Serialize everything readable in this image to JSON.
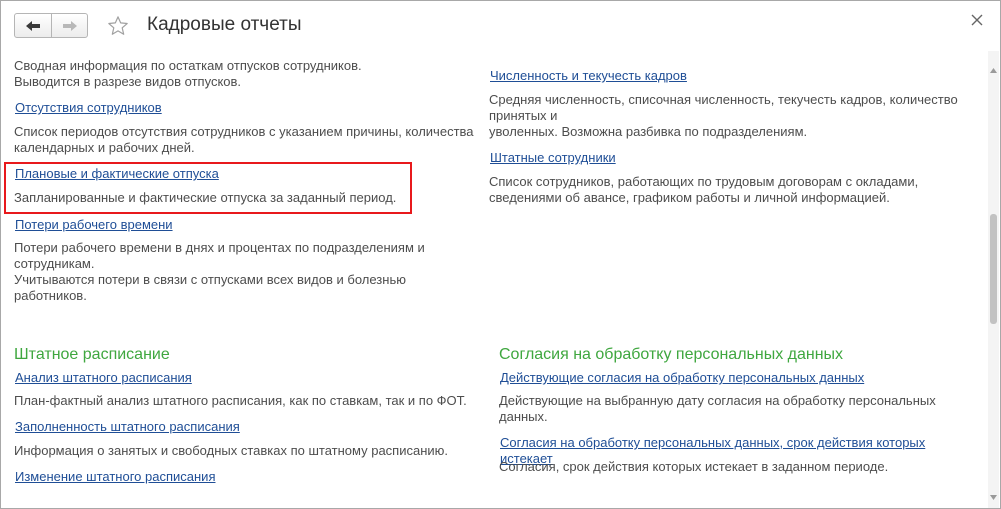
{
  "header": {
    "title": "Кадровые отчеты"
  },
  "left": {
    "intro_desc_1": "Сводная информация по остаткам отпусков сотрудников.",
    "intro_desc_2": "Выводится в разрезе видов отпусков.",
    "absences_link": "Отсутствия сотрудников",
    "absences_desc_1": "Список периодов отсутствия сотрудников с указанием причины, количества",
    "absences_desc_2": "календарных и рабочих дней.",
    "vacations_link": "Плановые и фактические отпуска",
    "vacations_desc": "Запланированные и фактические отпуска за заданный период.",
    "losses_link": "Потери рабочего времени",
    "losses_desc_1": "Потери рабочего времени в днях и процентах по подразделениям и",
    "losses_desc_2": "сотрудникам.",
    "losses_desc_3": "Учитываются потери в связи с отпусками всех видов и болезнью",
    "losses_desc_4": "работников.",
    "staffing_title": "Штатное расписание",
    "staffing_analysis_link": "Анализ штатного расписания",
    "staffing_analysis_desc": "План-фактный анализ штатного расписания, как по ставкам, так и по ФОТ.",
    "staffing_fill_link": "Заполненность штатного расписания",
    "staffing_fill_desc": "Информация о занятых и свободных ставках по штатному расписанию.",
    "staffing_change_link": "Изменение штатного расписания"
  },
  "right": {
    "headcount_link": "Численность и текучесть кадров",
    "headcount_desc_1": "Средняя численность, списочная численность, текучесть кадров, количество",
    "headcount_desc_2": "принятых и",
    "headcount_desc_3": "уволенных. Возможна разбивка по подразделениям.",
    "staff_link": "Штатные сотрудники",
    "staff_desc_1": "Список сотрудников, работающих по трудовым договорам с окладами,",
    "staff_desc_2": "сведениями об авансе, графиком работы и личной информацией.",
    "consent_title": "Согласия на обработку персональных данных",
    "consent_active_link": "Действующие согласия на обработку персональных данных",
    "consent_active_desc_1": "Действующие на выбранную дату согласия на обработку персональных",
    "consent_active_desc_2": "данных.",
    "consent_expiring_link": "Согласия на обработку персональных данных, срок действия которых истекает",
    "consent_expiring_desc": "Согласия, срок действия которых истекает в заданном периоде."
  },
  "icons": {
    "back": "arrow-left-icon",
    "forward": "arrow-right-icon",
    "favorite": "star-icon",
    "close": "close-icon"
  },
  "colors": {
    "link": "#1f4e96",
    "section_title": "#3fa73f",
    "highlight": "#e8191c",
    "text": "#4d4d4d"
  }
}
